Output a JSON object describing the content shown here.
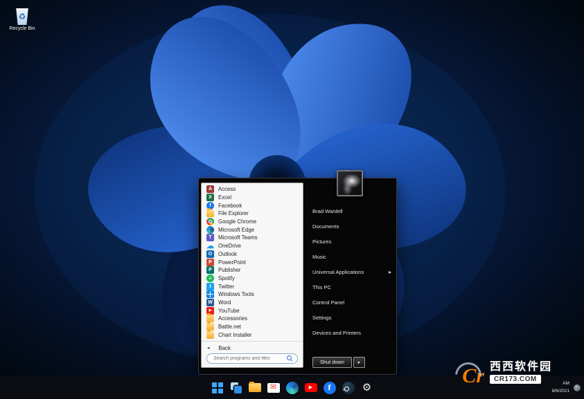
{
  "desktop": {
    "recycle_bin_label": "Recycle Bin"
  },
  "start_menu": {
    "left_items": [
      {
        "label": "Access",
        "icon": "access"
      },
      {
        "label": "Excel",
        "icon": "excel"
      },
      {
        "label": "Facebook",
        "icon": "facebook"
      },
      {
        "label": "File Explorer",
        "icon": "folder"
      },
      {
        "label": "Google Chrome",
        "icon": "chrome"
      },
      {
        "label": "Microsoft Edge",
        "icon": "edge"
      },
      {
        "label": "Microsoft Teams",
        "icon": "teams"
      },
      {
        "label": "OneDrive",
        "icon": "onedrive"
      },
      {
        "label": "Outlook",
        "icon": "outlook"
      },
      {
        "label": "PowerPoint",
        "icon": "powerpoint"
      },
      {
        "label": "Publisher",
        "icon": "publisher"
      },
      {
        "label": "Spotify",
        "icon": "spotify"
      },
      {
        "label": "Twitter",
        "icon": "twitter"
      },
      {
        "label": "Windows Tools",
        "icon": "windows-tools"
      },
      {
        "label": "Word",
        "icon": "word"
      },
      {
        "label": "YouTube",
        "icon": "youtube"
      },
      {
        "label": "Accessories",
        "icon": "folder"
      },
      {
        "label": "Battle.net",
        "icon": "folder"
      },
      {
        "label": "Chart Installer",
        "icon": "folder"
      }
    ],
    "back_label": "Back",
    "search_placeholder": "Search programs and files",
    "user_name": "Brad Wardell",
    "right_items": [
      {
        "label": "Documents"
      },
      {
        "label": "Pictures"
      },
      {
        "label": "Music"
      },
      {
        "label": "Universal Applications",
        "submenu": true
      },
      {
        "label": "This PC"
      },
      {
        "label": "Control Panel"
      },
      {
        "label": "Settings"
      },
      {
        "label": "Devices and Printers"
      }
    ],
    "shutdown_label": "Shut down"
  },
  "taskbar": {
    "icons": [
      "start",
      "task-view",
      "file-explorer",
      "mail",
      "edge",
      "youtube",
      "facebook",
      "steam",
      "settings"
    ]
  },
  "tray": {
    "time": "AM",
    "date": "8/6/2021"
  },
  "watermark": {
    "logo_text": "Cr",
    "site_name": "西西软件园",
    "domain": "CR173.COM"
  },
  "colors": {
    "accent_blue": "#1f63d8",
    "taskbar_bg": "#0b0d12",
    "watermark_orange": "#f07d00"
  }
}
